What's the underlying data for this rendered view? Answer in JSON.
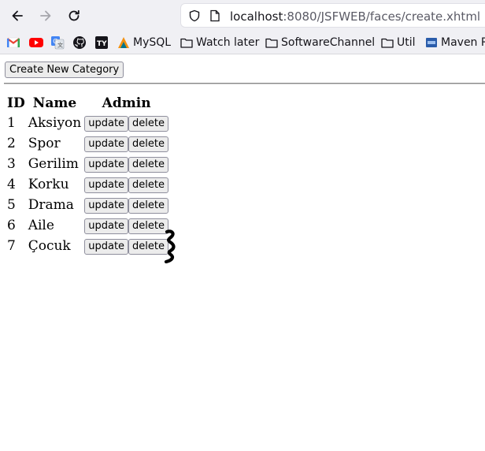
{
  "browser": {
    "url_host": "localhost",
    "url_rest": ":8080/JSFWEB/faces/create.xhtml",
    "bookmarks": [
      {
        "label": "MySQL",
        "icon": "mysql-icon"
      },
      {
        "label": "Watch later",
        "icon": "folder-icon"
      },
      {
        "label": "SoftwareChannel",
        "icon": "folder-icon"
      },
      {
        "label": "Util",
        "icon": "folder-icon"
      },
      {
        "label": "Maven R",
        "icon": "maven-icon"
      }
    ]
  },
  "page": {
    "create_button_label": "Create New Category",
    "table": {
      "headers": [
        "ID",
        "Name",
        "Admin"
      ],
      "update_label": "update",
      "delete_label": "delete",
      "rows": [
        {
          "id": "1",
          "name": "Aksiyon"
        },
        {
          "id": "2",
          "name": "Spor"
        },
        {
          "id": "3",
          "name": "Gerilim"
        },
        {
          "id": "4",
          "name": "Korku"
        },
        {
          "id": "5",
          "name": "Drama"
        },
        {
          "id": "6",
          "name": "Aile"
        },
        {
          "id": "7",
          "name": "Çocuk"
        }
      ]
    }
  }
}
